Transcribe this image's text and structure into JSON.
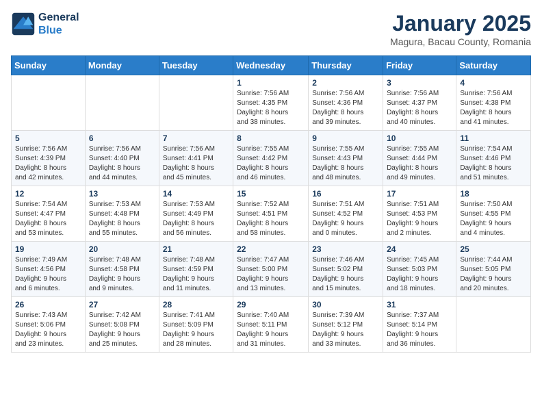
{
  "header": {
    "logo_line1": "General",
    "logo_line2": "Blue",
    "month_title": "January 2025",
    "subtitle": "Magura, Bacau County, Romania"
  },
  "weekdays": [
    "Sunday",
    "Monday",
    "Tuesday",
    "Wednesday",
    "Thursday",
    "Friday",
    "Saturday"
  ],
  "weeks": [
    [
      {
        "day": "",
        "content": ""
      },
      {
        "day": "",
        "content": ""
      },
      {
        "day": "",
        "content": ""
      },
      {
        "day": "1",
        "content": "Sunrise: 7:56 AM\nSunset: 4:35 PM\nDaylight: 8 hours\nand 38 minutes."
      },
      {
        "day": "2",
        "content": "Sunrise: 7:56 AM\nSunset: 4:36 PM\nDaylight: 8 hours\nand 39 minutes."
      },
      {
        "day": "3",
        "content": "Sunrise: 7:56 AM\nSunset: 4:37 PM\nDaylight: 8 hours\nand 40 minutes."
      },
      {
        "day": "4",
        "content": "Sunrise: 7:56 AM\nSunset: 4:38 PM\nDaylight: 8 hours\nand 41 minutes."
      }
    ],
    [
      {
        "day": "5",
        "content": "Sunrise: 7:56 AM\nSunset: 4:39 PM\nDaylight: 8 hours\nand 42 minutes."
      },
      {
        "day": "6",
        "content": "Sunrise: 7:56 AM\nSunset: 4:40 PM\nDaylight: 8 hours\nand 44 minutes."
      },
      {
        "day": "7",
        "content": "Sunrise: 7:56 AM\nSunset: 4:41 PM\nDaylight: 8 hours\nand 45 minutes."
      },
      {
        "day": "8",
        "content": "Sunrise: 7:55 AM\nSunset: 4:42 PM\nDaylight: 8 hours\nand 46 minutes."
      },
      {
        "day": "9",
        "content": "Sunrise: 7:55 AM\nSunset: 4:43 PM\nDaylight: 8 hours\nand 48 minutes."
      },
      {
        "day": "10",
        "content": "Sunrise: 7:55 AM\nSunset: 4:44 PM\nDaylight: 8 hours\nand 49 minutes."
      },
      {
        "day": "11",
        "content": "Sunrise: 7:54 AM\nSunset: 4:46 PM\nDaylight: 8 hours\nand 51 minutes."
      }
    ],
    [
      {
        "day": "12",
        "content": "Sunrise: 7:54 AM\nSunset: 4:47 PM\nDaylight: 8 hours\nand 53 minutes."
      },
      {
        "day": "13",
        "content": "Sunrise: 7:53 AM\nSunset: 4:48 PM\nDaylight: 8 hours\nand 55 minutes."
      },
      {
        "day": "14",
        "content": "Sunrise: 7:53 AM\nSunset: 4:49 PM\nDaylight: 8 hours\nand 56 minutes."
      },
      {
        "day": "15",
        "content": "Sunrise: 7:52 AM\nSunset: 4:51 PM\nDaylight: 8 hours\nand 58 minutes."
      },
      {
        "day": "16",
        "content": "Sunrise: 7:51 AM\nSunset: 4:52 PM\nDaylight: 9 hours\nand 0 minutes."
      },
      {
        "day": "17",
        "content": "Sunrise: 7:51 AM\nSunset: 4:53 PM\nDaylight: 9 hours\nand 2 minutes."
      },
      {
        "day": "18",
        "content": "Sunrise: 7:50 AM\nSunset: 4:55 PM\nDaylight: 9 hours\nand 4 minutes."
      }
    ],
    [
      {
        "day": "19",
        "content": "Sunrise: 7:49 AM\nSunset: 4:56 PM\nDaylight: 9 hours\nand 6 minutes."
      },
      {
        "day": "20",
        "content": "Sunrise: 7:48 AM\nSunset: 4:58 PM\nDaylight: 9 hours\nand 9 minutes."
      },
      {
        "day": "21",
        "content": "Sunrise: 7:48 AM\nSunset: 4:59 PM\nDaylight: 9 hours\nand 11 minutes."
      },
      {
        "day": "22",
        "content": "Sunrise: 7:47 AM\nSunset: 5:00 PM\nDaylight: 9 hours\nand 13 minutes."
      },
      {
        "day": "23",
        "content": "Sunrise: 7:46 AM\nSunset: 5:02 PM\nDaylight: 9 hours\nand 15 minutes."
      },
      {
        "day": "24",
        "content": "Sunrise: 7:45 AM\nSunset: 5:03 PM\nDaylight: 9 hours\nand 18 minutes."
      },
      {
        "day": "25",
        "content": "Sunrise: 7:44 AM\nSunset: 5:05 PM\nDaylight: 9 hours\nand 20 minutes."
      }
    ],
    [
      {
        "day": "26",
        "content": "Sunrise: 7:43 AM\nSunset: 5:06 PM\nDaylight: 9 hours\nand 23 minutes."
      },
      {
        "day": "27",
        "content": "Sunrise: 7:42 AM\nSunset: 5:08 PM\nDaylight: 9 hours\nand 25 minutes."
      },
      {
        "day": "28",
        "content": "Sunrise: 7:41 AM\nSunset: 5:09 PM\nDaylight: 9 hours\nand 28 minutes."
      },
      {
        "day": "29",
        "content": "Sunrise: 7:40 AM\nSunset: 5:11 PM\nDaylight: 9 hours\nand 31 minutes."
      },
      {
        "day": "30",
        "content": "Sunrise: 7:39 AM\nSunset: 5:12 PM\nDaylight: 9 hours\nand 33 minutes."
      },
      {
        "day": "31",
        "content": "Sunrise: 7:37 AM\nSunset: 5:14 PM\nDaylight: 9 hours\nand 36 minutes."
      },
      {
        "day": "",
        "content": ""
      }
    ]
  ]
}
